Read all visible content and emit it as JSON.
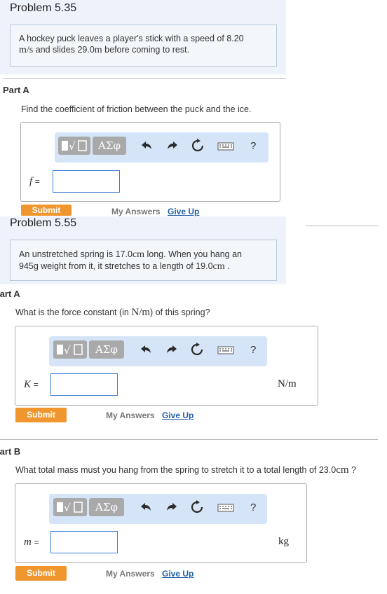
{
  "problem1": {
    "title": "Problem 5.35",
    "text_a": "A hockey puck leaves a player's stick with a speed of 8.20",
    "unit_a": "m/s",
    "text_b": " and slides 29.0",
    "unit_b": "m",
    "text_c": " before coming to rest.",
    "partA": {
      "label": "Part A",
      "question": "Find the coefficient of friction between the puck and the ice.",
      "var": "f",
      "eq": "=",
      "submit": "Submit",
      "my_answers": "My Answers",
      "give_up": "Give Up"
    }
  },
  "problem2": {
    "title": "Problem 5.55",
    "text_a": "An unstretched spring is 17.0",
    "unit_a": "cm",
    "text_b": " long. When you hang an",
    "text_c": "945g weight from it, it stretches to a length of 19.0",
    "unit_c": "cm",
    "text_d": " .",
    "partA": {
      "label": "Part A",
      "q_a": "What is the force constant (in ",
      "q_unit": "N/m",
      "q_b": ") of this spring?",
      "var": "K",
      "eq": "=",
      "unit": "N/m",
      "submit": "Submit",
      "my_answers": "My Answers",
      "give_up": "Give Up"
    },
    "partB": {
      "label": "Part B",
      "q_a": "What total mass must you hang from the spring to stretch it to a total length of 23.0",
      "q_unit": "cm",
      "q_b": " ?",
      "var": "m",
      "eq": "=",
      "unit": "kg",
      "submit": "Submit",
      "my_answers": "My Answers",
      "give_up": "Give Up"
    }
  },
  "toolbar": {
    "greek": "ΑΣφ",
    "help": "?",
    "icons": [
      "templates-icon",
      "undo-icon",
      "redo-icon",
      "reset-icon",
      "keyboard-icon",
      "help-icon"
    ]
  },
  "colors": {
    "submit": "#f0962e",
    "toolbar_bg": "#d5e5f7",
    "link": "#1f5fa8",
    "input_border": "#3a7bd5"
  }
}
